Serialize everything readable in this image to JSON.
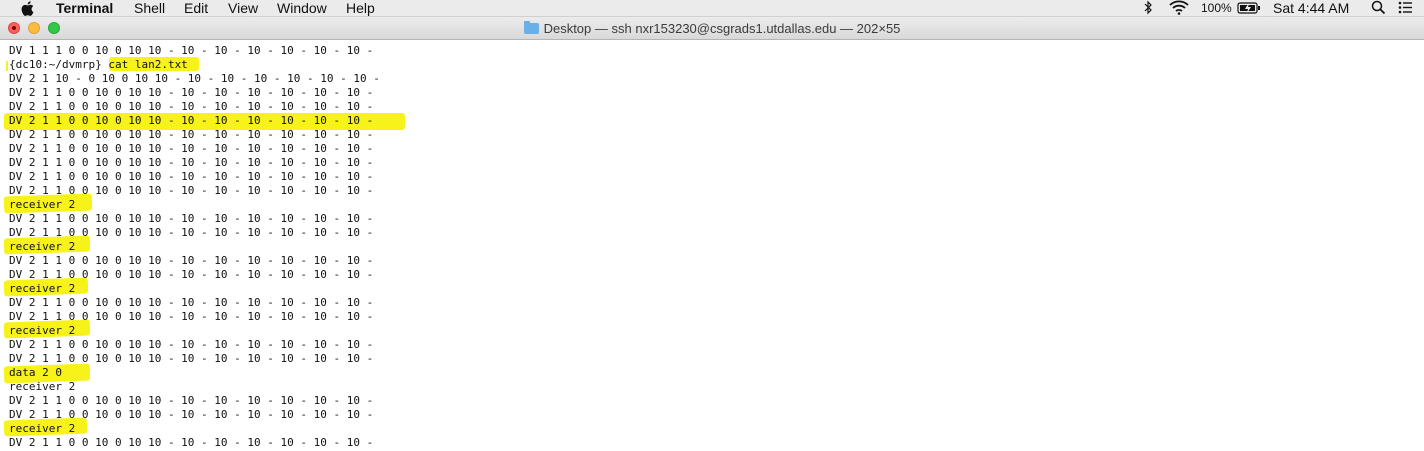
{
  "menubar": {
    "apple_icon": "apple-icon",
    "app_name": "Terminal",
    "menus": [
      "Shell",
      "Edit",
      "View",
      "Window",
      "Help"
    ],
    "status": {
      "bluetooth_icon": "bluetooth-icon",
      "wifi_icon": "wifi-icon",
      "battery_percent": "100%",
      "battery_icon": "battery-charging-icon",
      "clock": "Sat 4:44 AM",
      "search_icon": "spotlight-search-icon",
      "list_icon": "notification-center-icon"
    }
  },
  "window": {
    "title": "Desktop — ssh nxr153230@csgrads1.utdallas.edu — 202×55",
    "folder_icon": "folder-icon"
  },
  "terminal": {
    "prompt": "{dc10:~/dvmrp}",
    "command": "cat lan2.txt",
    "lines": [
      "DV 1 1 1 0 0 10 0 10 10 - 10 - 10 - 10 - 10 - 10 - 10 -",
      "{dc10:~/dvmrp} cat lan2.txt",
      "DV 2 1 10 - 0 10 0 10 10 - 10 - 10 - 10 - 10 - 10 - 10 -",
      "DV 2 1 1 0 0 10 0 10 10 - 10 - 10 - 10 - 10 - 10 - 10 -",
      "DV 2 1 1 0 0 10 0 10 10 - 10 - 10 - 10 - 10 - 10 - 10 -",
      "DV 2 1 1 0 0 10 0 10 10 - 10 - 10 - 10 - 10 - 10 - 10 -",
      "DV 2 1 1 0 0 10 0 10 10 - 10 - 10 - 10 - 10 - 10 - 10 -",
      "DV 2 1 1 0 0 10 0 10 10 - 10 - 10 - 10 - 10 - 10 - 10 -",
      "DV 2 1 1 0 0 10 0 10 10 - 10 - 10 - 10 - 10 - 10 - 10 -",
      "DV 2 1 1 0 0 10 0 10 10 - 10 - 10 - 10 - 10 - 10 - 10 -",
      "DV 2 1 1 0 0 10 0 10 10 - 10 - 10 - 10 - 10 - 10 - 10 -",
      "receiver 2",
      "DV 2 1 1 0 0 10 0 10 10 - 10 - 10 - 10 - 10 - 10 - 10 -",
      "DV 2 1 1 0 0 10 0 10 10 - 10 - 10 - 10 - 10 - 10 - 10 -",
      "receiver 2",
      "DV 2 1 1 0 0 10 0 10 10 - 10 - 10 - 10 - 10 - 10 - 10 -",
      "DV 2 1 1 0 0 10 0 10 10 - 10 - 10 - 10 - 10 - 10 - 10 -",
      "receiver 2",
      "DV 2 1 1 0 0 10 0 10 10 - 10 - 10 - 10 - 10 - 10 - 10 -",
      "DV 2 1 1 0 0 10 0 10 10 - 10 - 10 - 10 - 10 - 10 - 10 -",
      "receiver 2",
      "DV 2 1 1 0 0 10 0 10 10 - 10 - 10 - 10 - 10 - 10 - 10 -",
      "DV 2 1 1 0 0 10 0 10 10 - 10 - 10 - 10 - 10 - 10 - 10 -",
      "data 2 0",
      "receiver 2",
      "DV 2 1 1 0 0 10 0 10 10 - 10 - 10 - 10 - 10 - 10 - 10 -",
      "DV 2 1 1 0 0 10 0 10 10 - 10 - 10 - 10 - 10 - 10 - 10 -",
      "receiver 2",
      "DV 2 1 1 0 0 10 0 10 10 - 10 - 10 - 10 - 10 - 10 - 10 -"
    ],
    "highlight_color": "#f6f21a"
  }
}
